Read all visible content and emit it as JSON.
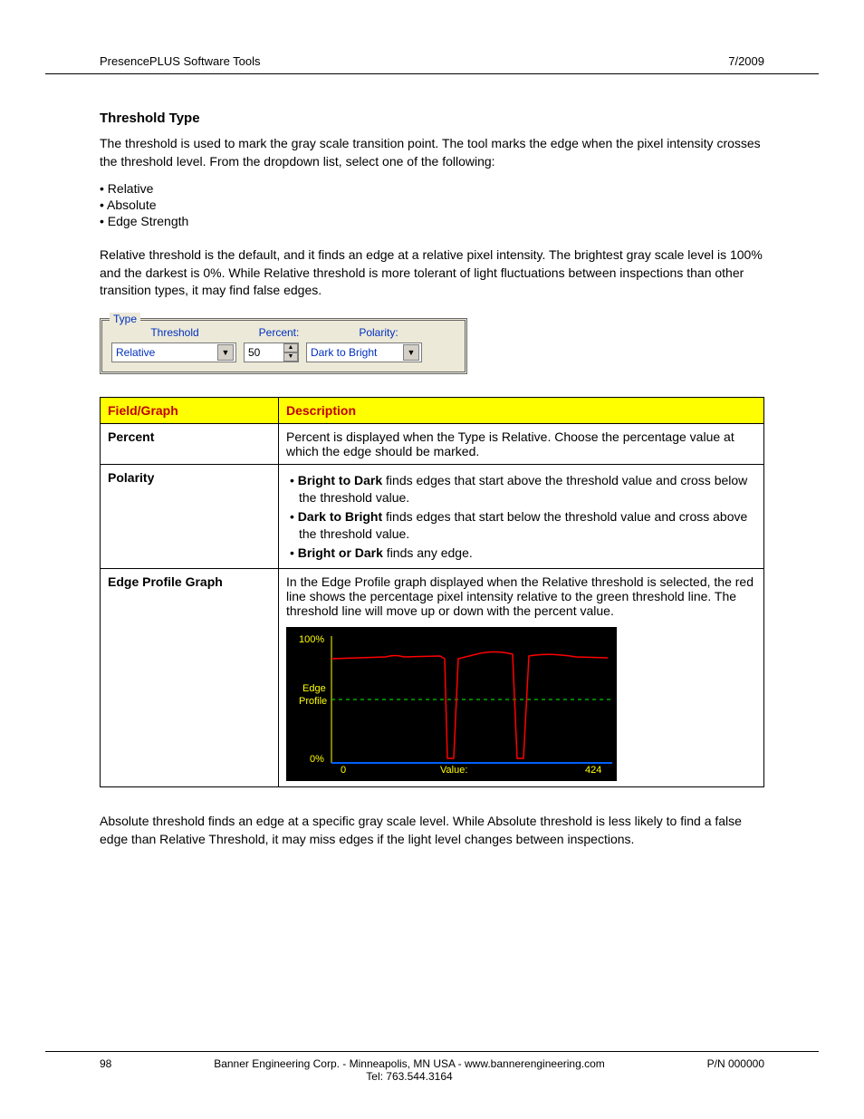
{
  "header": {
    "left": "PresencePLUS Software Tools",
    "right": "7/2009"
  },
  "section": {
    "title": "Threshold Type",
    "intro": "The threshold is used to mark the gray scale transition point. The tool marks the edge when the pixel intensity crosses the threshold level. From the dropdown list, select one of the following:",
    "bullets": [
      "Relative",
      "Absolute",
      "Edge Strength"
    ],
    "relative_para": "Relative threshold  is the default, and it finds an edge at a relative pixel intensity. The brightest gray scale level is 100% and the darkest is 0%. While Relative threshold is more tolerant of light fluctuations between inspections than other transition types, it may find false edges.",
    "absolute_para": "Absolute threshold  finds an edge at a specific gray scale level. While Absolute threshold is less likely to find a false edge than Relative Threshold, it may miss edges if the light level changes between inspections."
  },
  "panel": {
    "legend": "Type",
    "labels": {
      "threshold": "Threshold",
      "percent": "Percent:",
      "polarity": "Polarity:"
    },
    "values": {
      "threshold": "Relative",
      "percent": "50",
      "polarity": "Dark to Bright"
    }
  },
  "table": {
    "headers": {
      "field": "Field/Graph",
      "desc": "Description"
    },
    "rows": [
      {
        "field": "Percent",
        "desc_text": "Percent is displayed when the Type is Relative. Choose the percentage value at which the edge should be marked."
      },
      {
        "field": "Polarity",
        "bullets": [
          {
            "bold": "Bright to Dark",
            "rest": " finds edges that start above the threshold value and cross below the threshold value."
          },
          {
            "bold": "Dark to Bright",
            "rest": " finds edges that start below the threshold value and cross above the threshold value."
          },
          {
            "bold": "Bright or Dark",
            "rest": " finds any edge."
          }
        ]
      },
      {
        "field": "Edge Profile Graph",
        "desc_text": "In the Edge Profile graph displayed when the Relative threshold is selected, the red line shows the percentage pixel intensity relative to the green threshold line. The threshold line will move up or down with the percent value."
      }
    ]
  },
  "graph": {
    "ylabel_top": "100%",
    "ylabel_mid1": "Edge",
    "ylabel_mid2": "Profile",
    "ylabel_bot": "0%",
    "x_left": "0",
    "x_center": "Value:",
    "x_right": "424"
  },
  "footer": {
    "page": "98",
    "center1": "Banner Engineering Corp. - Minneapolis, MN USA - www.bannerengineering.com",
    "center2": "Tel: 763.544.3164",
    "right": "P/N 000000"
  }
}
